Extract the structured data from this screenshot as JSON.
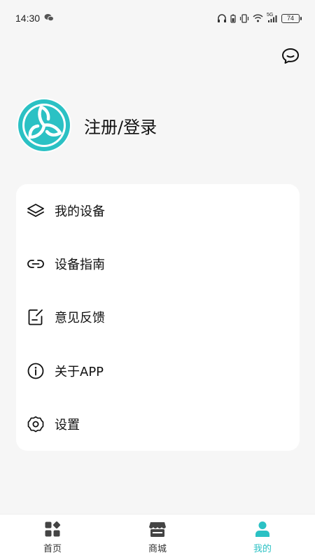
{
  "status_bar": {
    "time": "14:30",
    "battery": "74",
    "network": "5G"
  },
  "profile": {
    "login_label": "注册/登录"
  },
  "menu": {
    "items": [
      {
        "label": "我的设备",
        "icon": "layers-icon"
      },
      {
        "label": "设备指南",
        "icon": "link-icon"
      },
      {
        "label": "意见反馈",
        "icon": "feedback-edit-icon"
      },
      {
        "label": "关于APP",
        "icon": "info-icon"
      },
      {
        "label": "设置",
        "icon": "gear-icon"
      }
    ]
  },
  "tab_bar": {
    "tabs": [
      {
        "label": "首页",
        "icon": "grid-apps-icon",
        "active": false
      },
      {
        "label": "商城",
        "icon": "store-icon",
        "active": false
      },
      {
        "label": "我的",
        "icon": "person-icon",
        "active": true
      }
    ]
  },
  "colors": {
    "accent": "#2bc1c4",
    "background": "#f6f6f6",
    "card": "#ffffff"
  }
}
